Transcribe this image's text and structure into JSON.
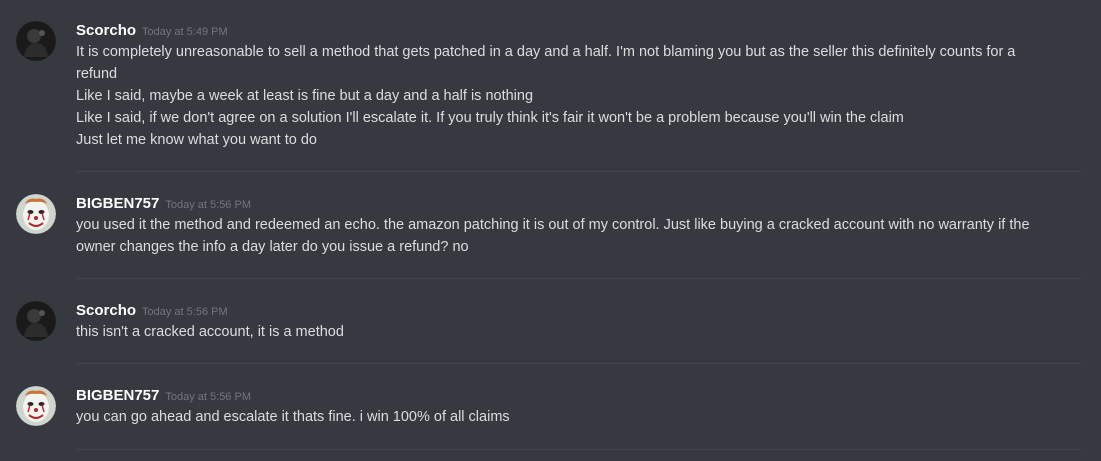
{
  "messages": [
    {
      "username": "Scorcho",
      "timestamp": "Today at 5:49 PM",
      "avatar_icon": "dark-figure-avatar",
      "lines": [
        "It is completely unreasonable to sell a method that gets patched in a day and a half. I'm not blaming you but as the seller this definitely counts for a",
        "refund",
        "Like I said, maybe a week at least is fine but a day and a half is nothing",
        "Like I said, if we don't agree on a solution I'll escalate it. If you truly think it's fair it won't be a problem because you'll win the claim",
        "Just let me know what you want to do"
      ]
    },
    {
      "username": "BIGBEN757",
      "timestamp": "Today at 5:56 PM",
      "avatar_icon": "clown-avatar",
      "lines": [
        "you used it the method and redeemed an echo. the amazon patching it is out of my control. Just like buying a cracked account with no warranty if the",
        "owner changes the info a day later do you issue a refund? no"
      ]
    },
    {
      "username": "Scorcho",
      "timestamp": "Today at 5:56 PM",
      "avatar_icon": "dark-figure-avatar",
      "lines": [
        "this isn't a cracked account, it is a method"
      ]
    },
    {
      "username": "BIGBEN757",
      "timestamp": "Today at 5:56 PM",
      "avatar_icon": "clown-avatar",
      "lines": [
        "you can go ahead and escalate it thats fine. i win 100% of all claims"
      ]
    }
  ]
}
